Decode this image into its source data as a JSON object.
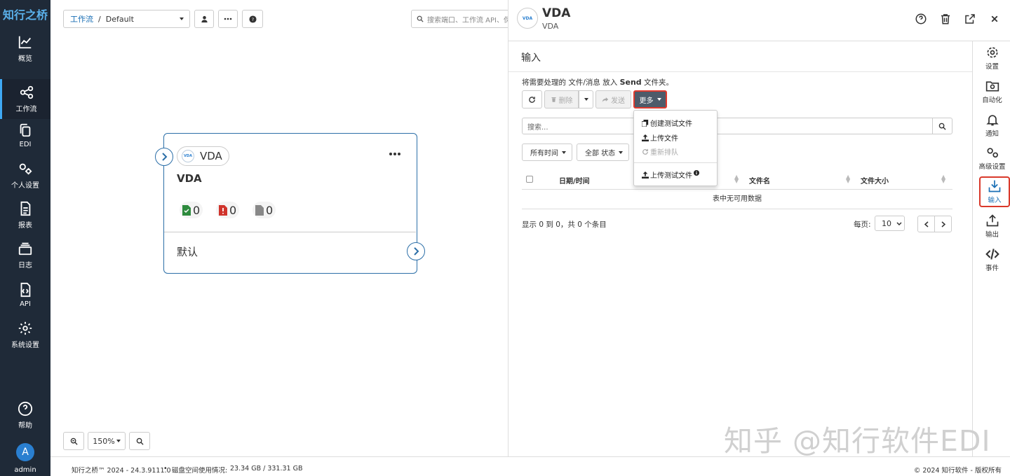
{
  "sidebar": {
    "logo": "知行之桥",
    "items": [
      {
        "label": "概览",
        "icon": "chart-line-icon"
      },
      {
        "label": "工作流",
        "icon": "share-nodes-icon"
      },
      {
        "label": "EDI",
        "icon": "copy-icon"
      },
      {
        "label": "个人设置",
        "icon": "user-gears-icon"
      },
      {
        "label": "报表",
        "icon": "file-report-icon"
      },
      {
        "label": "日志",
        "icon": "layers-icon"
      },
      {
        "label": "API",
        "icon": "file-code-icon"
      },
      {
        "label": "系统设置",
        "icon": "gear-icon"
      }
    ],
    "help": "帮助",
    "avatar": "A",
    "user": "admin",
    "active": "工作流"
  },
  "canvas": {
    "breadcrumb_link": "工作流",
    "breadcrumb_sep": "/",
    "workflow": "Default",
    "search_placeholder": "搜索端口、工作流 API、保",
    "zoom": "150%"
  },
  "card": {
    "chip": "VDA",
    "title": "VDA",
    "success_count": "0",
    "error_count": "0",
    "pending_count": "0",
    "footer": "默认"
  },
  "drawer": {
    "title": "VDA",
    "subtitle": "VDA",
    "section": "输入",
    "hint_pre": "将需要处理的 文件/消息 放入",
    "hint_bold": "Send",
    "hint_post": "文件夹。",
    "delete": "删除",
    "send": "发送",
    "more": "更多",
    "menu": [
      "创建测试文件",
      "上传文件",
      "重新排队",
      "上传测试文件"
    ],
    "search_placeholder": "搜索...",
    "filter_time": "所有时间",
    "filter_status": "全部 状态",
    "columns": [
      "日期/时间",
      "文件名",
      "文件大小"
    ],
    "empty": "表中无可用数据",
    "info": "显示 0 到 0，共 0 个条目",
    "per_page_label": "每页:",
    "per_page": "10"
  },
  "rightbar": {
    "items": [
      "设置",
      "自动化",
      "通知",
      "高级设置",
      "输入",
      "输出",
      "事件"
    ],
    "active": "输入"
  },
  "footer": {
    "version": "知行之桥™ 2024 - 24.3.9111.0",
    "dot": "•",
    "disk_label": "磁盘空间使用情况:",
    "disk": "23.34 GB / 331.31 GB",
    "copyright": "© 2024 知行软件 - 版权所有"
  },
  "watermark": "知乎 @知行软件EDI",
  "colors": {
    "sidebar": "#1f2a38",
    "accent": "#2c6fa8",
    "highlight": "#e03a2e",
    "success": "#2e8b3e",
    "error": "#d0342c"
  }
}
